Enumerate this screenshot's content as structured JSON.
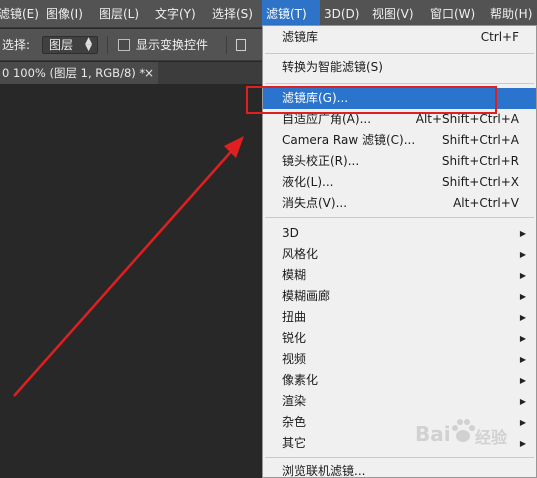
{
  "menubar": {
    "items": [
      {
        "label": "滤镜(E)"
      },
      {
        "label": "图像(I)"
      },
      {
        "label": "图层(L)"
      },
      {
        "label": "文字(Y)"
      },
      {
        "label": "选择(S)"
      },
      {
        "label": "滤镜(T)"
      },
      {
        "label": "3D(D)"
      },
      {
        "label": "视图(V)"
      },
      {
        "label": "窗口(W)"
      },
      {
        "label": "帮助(H)"
      }
    ]
  },
  "options": {
    "select_label": "选择:",
    "select_value": "图层",
    "checkbox_label": "显示变换控件"
  },
  "document": {
    "tab_title": "0 100% (图层 1, RGB/8) *",
    "close": "×"
  },
  "filter_menu": {
    "items": [
      {
        "label": "滤镜库",
        "shortcut": "Ctrl+F"
      },
      {
        "label": "转换为智能滤镜(S)",
        "shortcut": ""
      },
      {
        "label": "滤镜库(G)...",
        "shortcut": ""
      },
      {
        "label": "自适应广角(A)...",
        "shortcut": "Alt+Shift+Ctrl+A"
      },
      {
        "label": "Camera Raw 滤镜(C)...",
        "shortcut": "Shift+Ctrl+A"
      },
      {
        "label": "镜头校正(R)...",
        "shortcut": "Shift+Ctrl+R"
      },
      {
        "label": "液化(L)...",
        "shortcut": "Shift+Ctrl+X"
      },
      {
        "label": "消失点(V)...",
        "shortcut": "Alt+Ctrl+V"
      },
      {
        "label": "3D"
      },
      {
        "label": "风格化"
      },
      {
        "label": "模糊"
      },
      {
        "label": "模糊画廊"
      },
      {
        "label": "扭曲"
      },
      {
        "label": "锐化"
      },
      {
        "label": "视频"
      },
      {
        "label": "像素化"
      },
      {
        "label": "渲染"
      },
      {
        "label": "杂色"
      },
      {
        "label": "其它"
      },
      {
        "label": "浏览联机滤镜..."
      }
    ]
  },
  "watermark": {
    "text_left": "Bai",
    "text_right": "经验"
  },
  "colors": {
    "accent": "#2a74cd",
    "annotation": "#e02020"
  }
}
